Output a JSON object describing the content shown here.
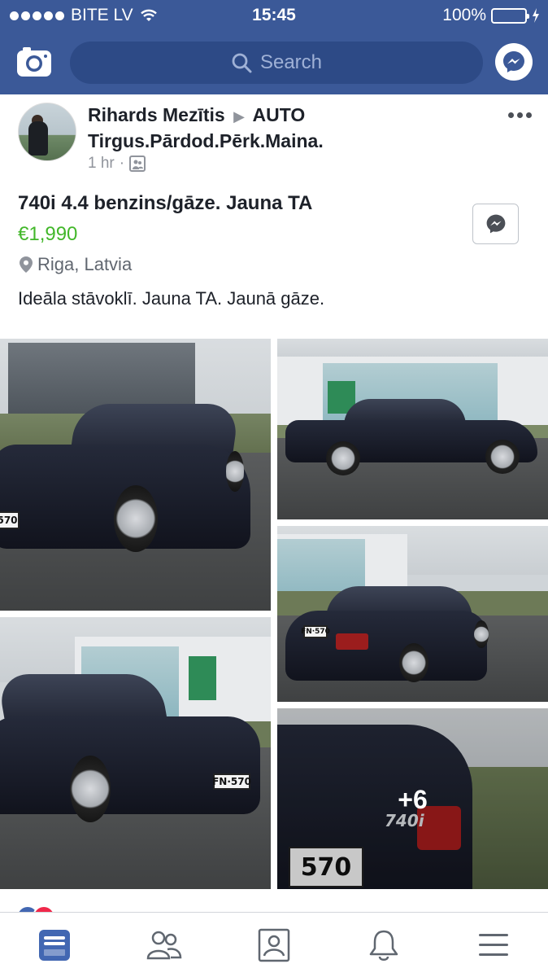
{
  "status_bar": {
    "carrier": "BITE LV",
    "time": "15:45",
    "battery": "100%"
  },
  "search": {
    "placeholder": "Search"
  },
  "post": {
    "author": "Rihards Mezītis",
    "group_line1": "AUTO",
    "group_line2": "Tirgus.Pārdod.Pērk.Maina.",
    "time": "1 hr",
    "dot": "·",
    "title": "740i 4.4 benzins/gāze. Jauna TA",
    "price": "€1,990",
    "location": "Riga, Latvia",
    "description": "Ideāla stāvoklī. Jauna TA. Jaunā gāze.",
    "more_photos": "+6"
  },
  "colors": {
    "brand_blue": "#3b5998",
    "price_green": "#42b72a",
    "active_tab": "#4267b2"
  },
  "icons": {
    "camera": "camera-icon",
    "search": "search-icon",
    "messenger": "messenger-icon",
    "more": "more-horizontal-icon",
    "location": "location-pin-icon",
    "group": "group-photo-icon",
    "tab_feed": "news-feed-icon",
    "tab_friends": "friends-icon",
    "tab_marketplace": "profile-card-icon",
    "tab_notifications": "bell-icon",
    "tab_menu": "menu-icon"
  }
}
